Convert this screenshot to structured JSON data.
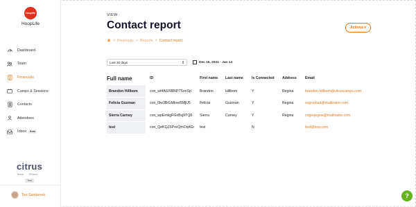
{
  "app": {
    "logo_badge": "hooplife",
    "logo_text": "HoopLife"
  },
  "sidebar": {
    "items": [
      {
        "label": "Dashboard",
        "icon": "dashboard-icon",
        "active": false
      },
      {
        "label": "Team",
        "icon": "team-icon",
        "active": false
      },
      {
        "label": "Financials",
        "icon": "financials-icon",
        "active": true
      },
      {
        "label": "Camps & Sessions",
        "icon": "camps-icon",
        "active": false
      },
      {
        "label": "Contacts",
        "icon": "contacts-icon",
        "active": false
      },
      {
        "label": "Attendees",
        "icon": "attendees-icon",
        "active": false
      },
      {
        "label": "Inbox",
        "icon": "inbox-icon",
        "active": false,
        "badge": "Beta"
      }
    ],
    "brand": "citrus",
    "legal": {
      "terms": "Terms",
      "sep": "·",
      "privacy": "Privacy"
    },
    "env_badge": "Test",
    "user_name": "Tori Sambrook"
  },
  "header": {
    "eyebrow": "VIEW",
    "title": "Contact report",
    "actions_label": "Actions ▾"
  },
  "breadcrumb": {
    "home_icon": "home-icon",
    "sep": ">",
    "items": [
      "Financials",
      "Reports",
      "Contact report"
    ]
  },
  "filters": {
    "range_select": "Last 30 days",
    "date_range": "Dec 15, 2021 - Jan 14"
  },
  "table": {
    "headers": [
      "Full name",
      "ID",
      "First name",
      "Last name",
      "Is Connected",
      "Address",
      "Email"
    ],
    "rows": [
      {
        "full_name": "Brandon Hillbom",
        "id": "con_wt4ASXBBIP7SonSp",
        "first": "Brandon",
        "last": "Hillbom",
        "connected": "Y",
        "address": "Regina",
        "email": "brandon.hillbom@citruscamps.com"
      },
      {
        "full_name": "Felicia Guzman",
        "id": "con_l9w3BiGMbveBMjU5",
        "first": "Felicia",
        "last": "Guzman",
        "connected": "Y",
        "address": "Regina",
        "email": "sojyvahad@mailinator.com"
      },
      {
        "full_name": "Sierra Carney",
        "id": "con_wpEmkgFGxBsj9TQ8",
        "first": "Sierra",
        "last": "Carney",
        "connected": "Y",
        "address": "Regina",
        "email": "cegeqegew@mailinator.com"
      },
      {
        "full_name": "test",
        "id": "con_QeKQZ6PxvQmOq4Gr",
        "first": "test",
        "last": "",
        "connected": "N",
        "address": "",
        "email": "test@test.com"
      }
    ]
  },
  "help_label": "?",
  "colors": {
    "accent": "#e8781f",
    "brand_red": "#e0301e",
    "help_green": "#65b31f"
  }
}
